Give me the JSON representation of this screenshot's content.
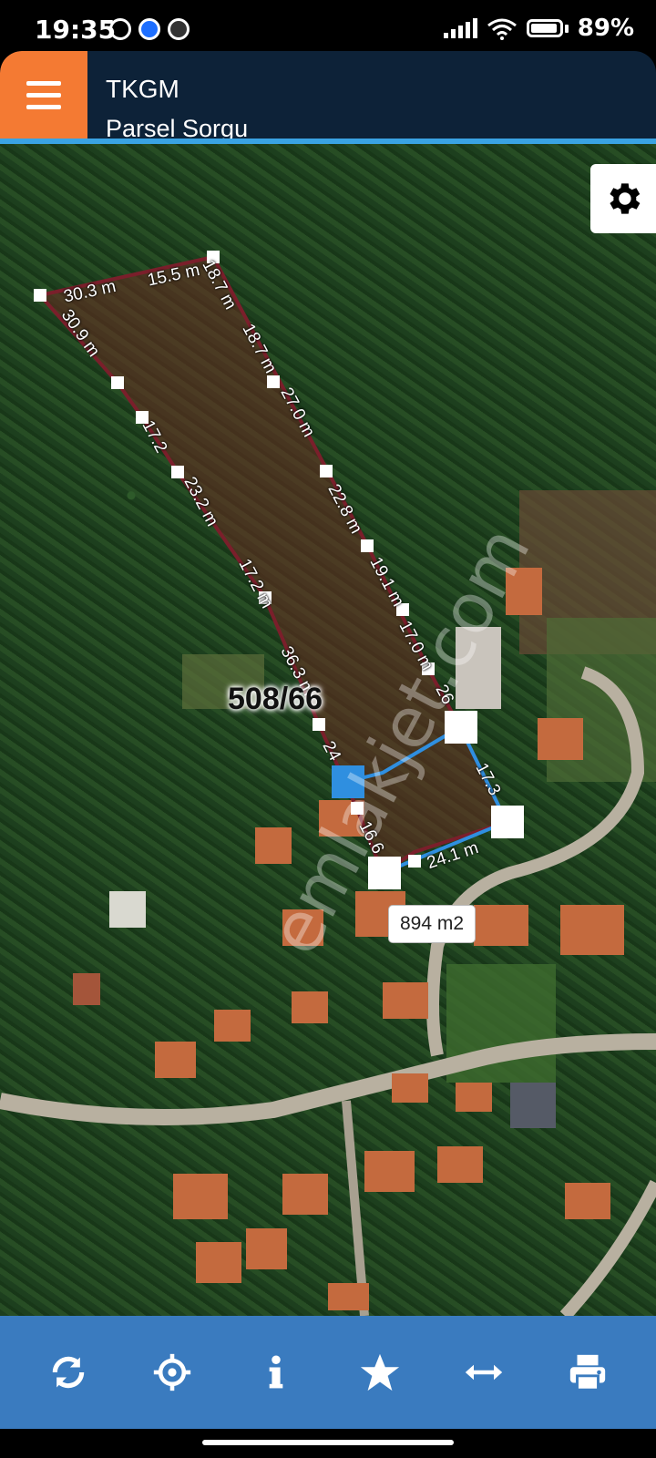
{
  "status_bar": {
    "time": "19:35",
    "battery": "89%"
  },
  "header": {
    "title": "TKGM",
    "subtitle": "Parsel Sorgu"
  },
  "map": {
    "parcel_number": "508/66",
    "area": "894 m2",
    "watermark": "emlakjet.com",
    "segments": [
      "30.3 m",
      "15.5 m",
      "18.7 m",
      "18.7 m",
      "27.0 m",
      "22.8 m",
      "19.1 m",
      "17.0 m",
      "26",
      "17.3",
      "24.1 m",
      "16.6",
      "24",
      "36.3 m",
      "17.2 m",
      "23.2 m",
      "17.2",
      "30.9 m"
    ]
  },
  "toolbar": {
    "refresh_icon": "refresh-icon",
    "locate_icon": "crosshair-icon",
    "info_icon": "info-icon",
    "favorite_icon": "star-icon",
    "measure_icon": "horizontal-arrows-icon",
    "print_icon": "printer-icon"
  },
  "colors": {
    "header_bg": "#0d2238",
    "menu_bg": "#f47a33",
    "accent_line": "#3aa3e3",
    "toolbar_bg": "#3a7bbf"
  }
}
